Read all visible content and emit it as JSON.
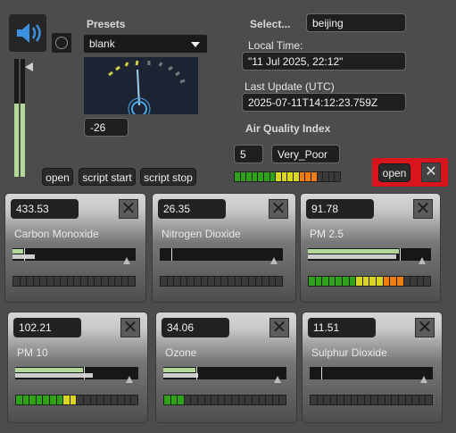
{
  "presets": {
    "label": "Presets",
    "selected": "blank",
    "dial_value": "-26"
  },
  "city": {
    "label": "Select...",
    "value": "beijing"
  },
  "local_time": {
    "label": "Local Time:",
    "value": "\"11 Jul 2025, 22:12\""
  },
  "last_update": {
    "label": "Last Update (UTC)",
    "value": "2025-07-11T14:12:23.759Z"
  },
  "aqi": {
    "label": "Air Quality Index",
    "number": "5",
    "category": "Very_Poor"
  },
  "buttons": {
    "open": "open",
    "script_start": "script start",
    "script_stop": "script stop",
    "open_red": "open",
    "close_glyph": "✕"
  },
  "colors": {
    "red_accent": "#d8141c",
    "led_green": "#2fa11a",
    "led_yellow": "#d8d61e",
    "led_orange": "#ef7d12",
    "led_red": "#e12424",
    "slider_green": "#b4d89a"
  },
  "pollutants": [
    {
      "value": "433.53",
      "name": "Carbon Monoxide",
      "bar1": 0.09,
      "bar2": 0.18,
      "leds_lit": 0
    },
    {
      "value": "26.35",
      "name": "Nitrogen Dioxide",
      "bar1": 0.0,
      "bar2": 0.0,
      "leds_lit": 0
    },
    {
      "value": "91.78",
      "name": "PM 2.5",
      "bar1": 0.74,
      "bar2": 0.72,
      "leds_lit": 14
    },
    {
      "value": "102.21",
      "name": "PM 10",
      "bar1": 0.55,
      "bar2": 0.63,
      "leds_lit": 9
    },
    {
      "value": "34.06",
      "name": "Ozone",
      "bar1": 0.26,
      "bar2": 0.28,
      "leds_lit": 3
    },
    {
      "value": "11.51",
      "name": "Sulphur Dioxide",
      "bar1": 0.0,
      "bar2": 0.0,
      "leds_lit": 0
    }
  ],
  "aqi_leds_lit": 14
}
